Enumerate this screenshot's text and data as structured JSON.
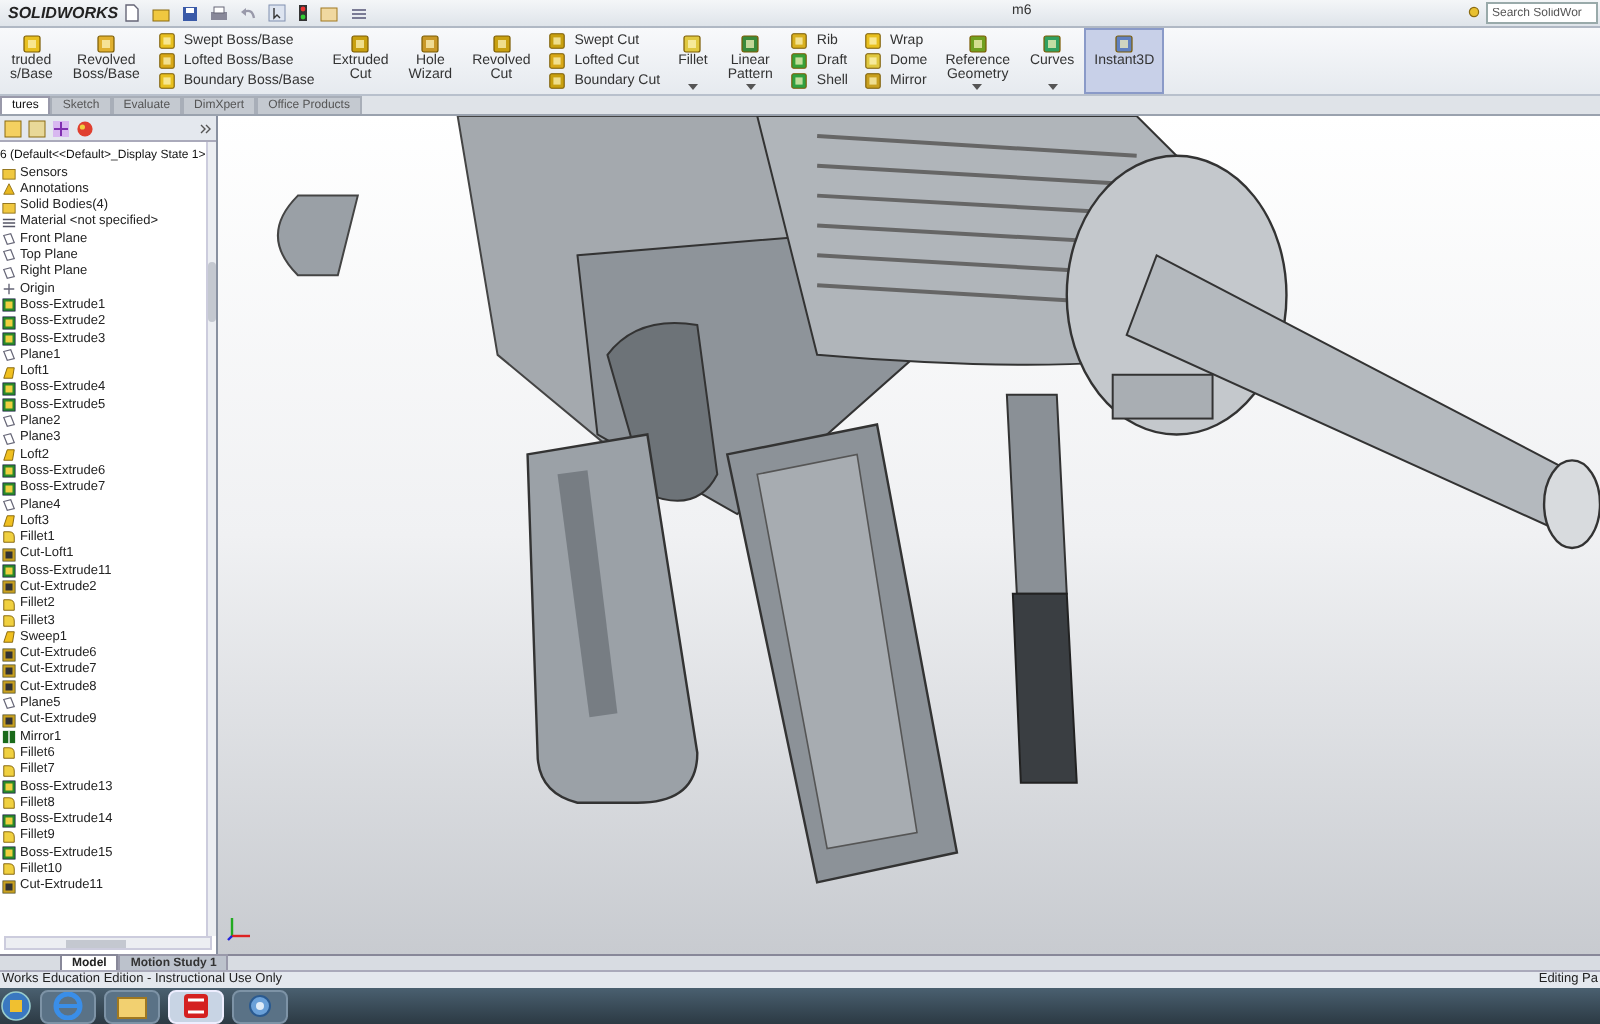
{
  "title_bar": {
    "app_name": "SOLIDWORKS",
    "document_title": "m6",
    "search_placeholder": "Search SolidWor"
  },
  "ribbon": [
    {
      "kind": "large",
      "lines": [
        "truded",
        "s/Base"
      ],
      "dropdown": false,
      "selected": false
    },
    {
      "kind": "large",
      "lines": [
        "Revolved",
        "Boss/Base"
      ],
      "dropdown": false,
      "selected": false
    },
    {
      "kind": "stack",
      "items": [
        {
          "label": "Swept Boss/Base"
        },
        {
          "label": "Lofted Boss/Base"
        },
        {
          "label": "Boundary Boss/Base"
        }
      ]
    },
    {
      "kind": "large",
      "lines": [
        "Extruded",
        "Cut"
      ],
      "dropdown": false,
      "selected": false
    },
    {
      "kind": "large",
      "lines": [
        "Hole",
        "Wizard"
      ],
      "dropdown": false,
      "selected": false
    },
    {
      "kind": "large",
      "lines": [
        "Revolved",
        "Cut"
      ],
      "dropdown": false,
      "selected": false
    },
    {
      "kind": "stack",
      "items": [
        {
          "label": "Swept Cut"
        },
        {
          "label": "Lofted Cut"
        },
        {
          "label": "Boundary Cut"
        }
      ]
    },
    {
      "kind": "large",
      "lines": [
        "Fillet"
      ],
      "dropdown": true,
      "selected": false
    },
    {
      "kind": "large",
      "lines": [
        "Linear",
        "Pattern"
      ],
      "dropdown": true,
      "selected": false
    },
    {
      "kind": "stack",
      "items": [
        {
          "label": "Rib"
        },
        {
          "label": "Draft"
        },
        {
          "label": "Shell"
        }
      ]
    },
    {
      "kind": "stack",
      "items": [
        {
          "label": "Wrap"
        },
        {
          "label": "Dome"
        },
        {
          "label": "Mirror"
        }
      ]
    },
    {
      "kind": "large",
      "lines": [
        "Reference",
        "Geometry"
      ],
      "dropdown": true,
      "selected": false
    },
    {
      "kind": "large",
      "lines": [
        "Curves"
      ],
      "dropdown": true,
      "selected": false
    },
    {
      "kind": "large",
      "lines": [
        "Instant3D"
      ],
      "dropdown": false,
      "selected": true
    }
  ],
  "command_tabs": [
    {
      "label": "tures",
      "selected": true
    },
    {
      "label": "Sketch",
      "selected": false
    },
    {
      "label": "Evaluate",
      "selected": false
    },
    {
      "label": "DimXpert",
      "selected": false
    },
    {
      "label": "Office Products",
      "selected": false
    }
  ],
  "feature_tree": {
    "root": "6 (Default<<Default>_Display State 1>",
    "items": [
      {
        "kind": "folder",
        "label": "Sensors"
      },
      {
        "kind": "annotation",
        "label": "Annotations"
      },
      {
        "kind": "folder",
        "label": "Solid Bodies(4)"
      },
      {
        "kind": "material",
        "label": "Material <not specified>"
      },
      {
        "kind": "plane",
        "label": "Front Plane"
      },
      {
        "kind": "plane",
        "label": "Top Plane"
      },
      {
        "kind": "plane",
        "label": "Right Plane"
      },
      {
        "kind": "origin",
        "label": "Origin"
      },
      {
        "kind": "boss",
        "label": "Boss-Extrude1"
      },
      {
        "kind": "boss",
        "label": "Boss-Extrude2"
      },
      {
        "kind": "boss",
        "label": "Boss-Extrude3"
      },
      {
        "kind": "plane",
        "label": "Plane1"
      },
      {
        "kind": "loft",
        "label": "Loft1"
      },
      {
        "kind": "boss",
        "label": "Boss-Extrude4"
      },
      {
        "kind": "boss",
        "label": "Boss-Extrude5"
      },
      {
        "kind": "plane",
        "label": "Plane2"
      },
      {
        "kind": "plane",
        "label": "Plane3"
      },
      {
        "kind": "loft",
        "label": "Loft2"
      },
      {
        "kind": "boss",
        "label": "Boss-Extrude6"
      },
      {
        "kind": "boss",
        "label": "Boss-Extrude7"
      },
      {
        "kind": "plane",
        "label": "Plane4"
      },
      {
        "kind": "loft",
        "label": "Loft3"
      },
      {
        "kind": "fillet",
        "label": "Fillet1"
      },
      {
        "kind": "cut",
        "label": "Cut-Loft1"
      },
      {
        "kind": "boss",
        "label": "Boss-Extrude11"
      },
      {
        "kind": "cut",
        "label": "Cut-Extrude2"
      },
      {
        "kind": "fillet",
        "label": "Fillet2"
      },
      {
        "kind": "fillet",
        "label": "Fillet3"
      },
      {
        "kind": "loft",
        "label": "Sweep1"
      },
      {
        "kind": "cut",
        "label": "Cut-Extrude6"
      },
      {
        "kind": "cut",
        "label": "Cut-Extrude7"
      },
      {
        "kind": "cut",
        "label": "Cut-Extrude8"
      },
      {
        "kind": "plane",
        "label": "Plane5"
      },
      {
        "kind": "cut",
        "label": "Cut-Extrude9"
      },
      {
        "kind": "mirror",
        "label": "Mirror1"
      },
      {
        "kind": "fillet",
        "label": "Fillet6"
      },
      {
        "kind": "fillet",
        "label": "Fillet7"
      },
      {
        "kind": "boss",
        "label": "Boss-Extrude13"
      },
      {
        "kind": "fillet",
        "label": "Fillet8"
      },
      {
        "kind": "boss",
        "label": "Boss-Extrude14"
      },
      {
        "kind": "fillet",
        "label": "Fillet9"
      },
      {
        "kind": "boss",
        "label": "Boss-Extrude15"
      },
      {
        "kind": "fillet",
        "label": "Fillet10"
      },
      {
        "kind": "cut",
        "label": "Cut-Extrude11"
      }
    ]
  },
  "model_tabs": [
    {
      "label": "Model",
      "selected": true
    },
    {
      "label": "Motion Study 1",
      "selected": false
    }
  ],
  "status_bar": {
    "left": "Works Education Edition - Instructional Use Only",
    "right": "Editing Pa"
  },
  "taskbar": [
    {
      "selected": false
    },
    {
      "selected": false
    },
    {
      "selected": true
    },
    {
      "selected": false
    }
  ]
}
